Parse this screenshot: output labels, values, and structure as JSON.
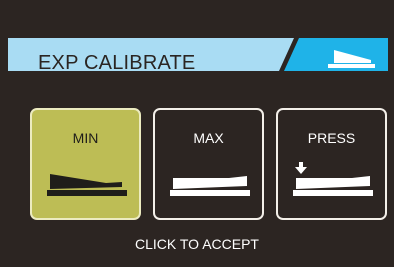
{
  "header": {
    "title": "EXP CALIBRATE",
    "icon": "expression-pedal-icon",
    "colors": {
      "bar": "#a9dcf3",
      "accent": "#1fb3e8"
    }
  },
  "buttons": [
    {
      "label": "MIN",
      "icon": "pedal-heel-down-icon",
      "selected": true
    },
    {
      "label": "MAX",
      "icon": "pedal-toe-down-icon",
      "selected": false
    },
    {
      "label": "PRESS",
      "icon": "pedal-press-arrow-icon",
      "selected": false
    }
  ],
  "footer": {
    "text": "CLICK TO ACCEPT"
  },
  "colors": {
    "selected_fill": "#bdbd55",
    "background": "#2c2522"
  }
}
